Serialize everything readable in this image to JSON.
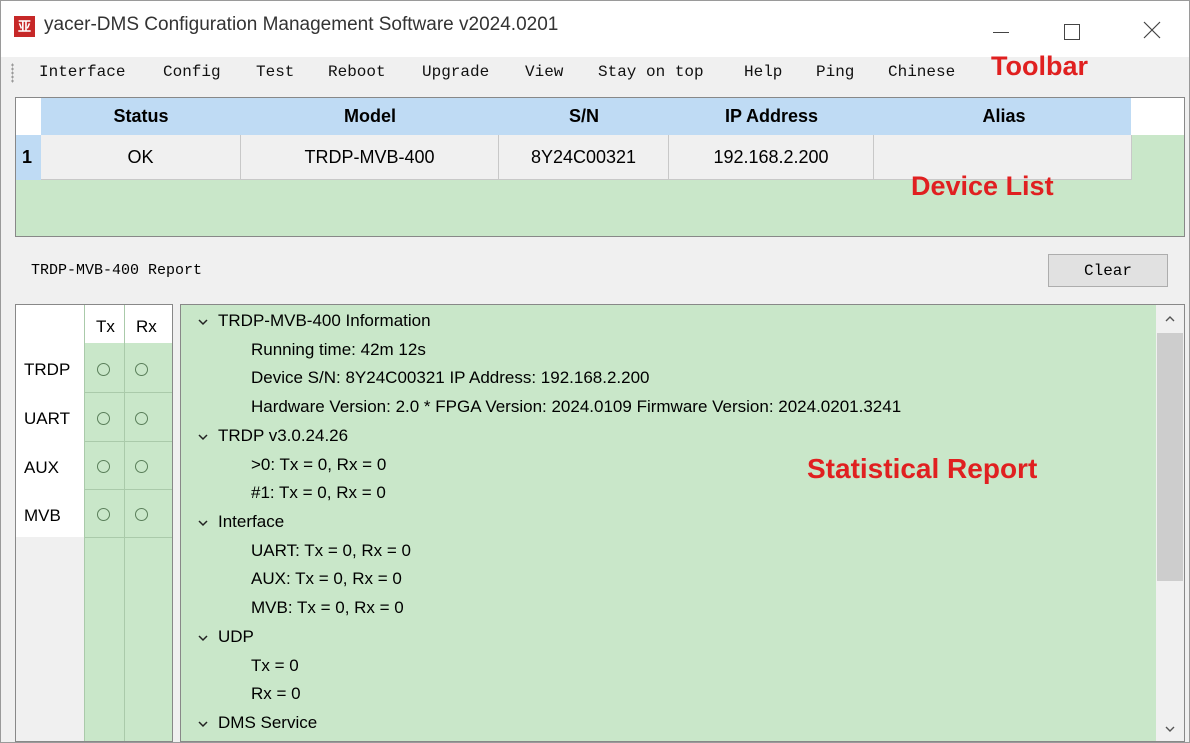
{
  "window": {
    "icon_text": "亚",
    "title": "yacer-DMS Configuration Management Software v2024.0201"
  },
  "menu": {
    "items": [
      "Interface",
      "Config",
      "Test",
      "Reboot",
      "Upgrade",
      "View",
      "Stay on top",
      "Help",
      "Ping",
      "Chinese"
    ]
  },
  "annotations": {
    "toolbar": "Toolbar",
    "device_list": "Device List",
    "statistical_report": "Statistical Report",
    "color": "#e02020"
  },
  "device_list": {
    "columns": [
      "Status",
      "Model",
      "S/N",
      "IP Address",
      "Alias"
    ],
    "rows": [
      {
        "index": "1",
        "status": "OK",
        "model": "TRDP-MVB-400",
        "sn": "8Y24C00321",
        "ip": "192.168.2.200",
        "alias": ""
      }
    ]
  },
  "report": {
    "title": "TRDP-MVB-400 Report",
    "clear_label": "Clear"
  },
  "status_panel": {
    "headers": [
      "Tx",
      "Rx"
    ],
    "rows": [
      "TRDP",
      "UART",
      "AUX",
      "MVB"
    ]
  },
  "tree": {
    "lines": [
      "TRDP-MVB-400 Information",
      "Running time: 42m 12s",
      "Device S/N: 8Y24C00321    IP Address: 192.168.2.200",
      "Hardware Version: 2.0 *    FPGA Version: 2024.0109    Firmware Version: 2024.0201.3241",
      "TRDP    v3.0.24.26",
      ">0: Tx = 0, Rx = 0",
      "#1: Tx = 0, Rx = 0",
      "Interface",
      "UART: Tx = 0, Rx = 0",
      "AUX: Tx = 0, Rx = 0",
      "MVB: Tx = 0, Rx = 0",
      "UDP",
      "Tx = 0",
      "Rx = 0",
      "DMS Service"
    ]
  },
  "colors": {
    "panel_green": "#c9e7c9",
    "header_blue": "#bfdbf4"
  }
}
